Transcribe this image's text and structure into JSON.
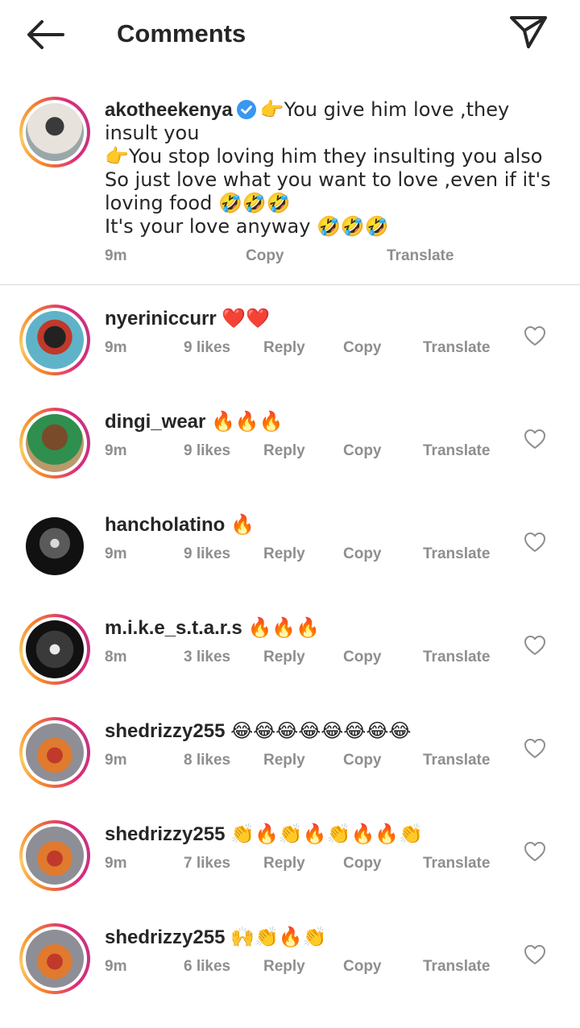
{
  "header": {
    "title": "Comments",
    "back_icon": "arrow-left-icon",
    "send_icon": "paper-plane-icon"
  },
  "caption": {
    "username": "akotheekenya",
    "verified": true,
    "text": "👉You give him love ,they insult you\n👉You stop loving  him they insulting you  also\nSo just love what you want to love ,even if it's loving food 🤣🤣🤣\nIt's your love anyway 🤣🤣🤣",
    "time": "9m",
    "copy": "Copy",
    "translate": "Translate"
  },
  "comments": [
    {
      "username": "nyeriniccurr",
      "text": "❤️❤️",
      "time": "9m",
      "likes": "9 likes",
      "reply": "Reply",
      "copy": "Copy",
      "translate": "Translate"
    },
    {
      "username": "dingi_wear",
      "text": "🔥🔥🔥",
      "time": "9m",
      "likes": "9 likes",
      "reply": "Reply",
      "copy": "Copy",
      "translate": "Translate"
    },
    {
      "username": "hancholatino",
      "text": "🔥",
      "time": "9m",
      "likes": "9 likes",
      "reply": "Reply",
      "copy": "Copy",
      "translate": "Translate"
    },
    {
      "username": "m.i.k.e_s.t.a.r.s",
      "text": "🔥🔥🔥",
      "time": "8m",
      "likes": "3 likes",
      "reply": "Reply",
      "copy": "Copy",
      "translate": "Translate"
    },
    {
      "username": "shedrizzy255",
      "text": "😂😂😂😂😂😂😂😂",
      "time": "9m",
      "likes": "8 likes",
      "reply": "Reply",
      "copy": "Copy",
      "translate": "Translate"
    },
    {
      "username": "shedrizzy255",
      "text": "👏🔥👏🔥👏🔥🔥👏",
      "time": "9m",
      "likes": "7 likes",
      "reply": "Reply",
      "copy": "Copy",
      "translate": "Translate"
    },
    {
      "username": "shedrizzy255",
      "text": "🙌👏🔥👏",
      "time": "9m",
      "likes": "6 likes",
      "reply": "Reply",
      "copy": "Copy",
      "translate": "Translate"
    }
  ],
  "colors": {
    "text": "#262626",
    "meta": "#8e8e8e",
    "verified": "#3897f0",
    "divider": "#dbdbdb"
  }
}
